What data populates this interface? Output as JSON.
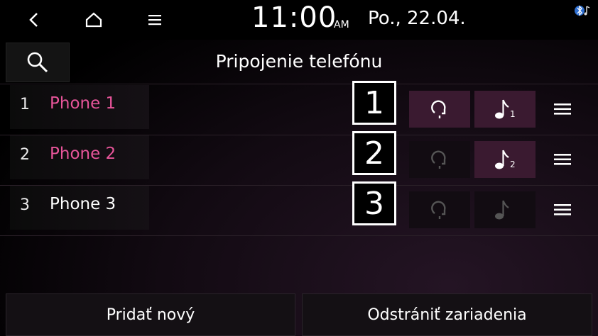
{
  "statusbar": {
    "time": "11:00",
    "ampm": "AM",
    "date": "Po., 22.04.",
    "icons": [
      "back-icon",
      "home-icon",
      "menu-icon",
      "bluetooth-audio-icon"
    ]
  },
  "header": {
    "title": "Pripojenie telefónu",
    "search_icon": "search-icon"
  },
  "phones": [
    {
      "number": "1",
      "name": "Phone 1",
      "name_color": "#e8559a",
      "callout": "1",
      "handsfree_on": true,
      "audio_on": true,
      "audio_badge": "1"
    },
    {
      "number": "2",
      "name": "Phone 2",
      "name_color": "#e8559a",
      "callout": "2",
      "handsfree_on": false,
      "audio_on": true,
      "audio_badge": "2"
    },
    {
      "number": "3",
      "name": "Phone 3",
      "name_color": "#ffffff",
      "callout": "3",
      "handsfree_on": false,
      "audio_on": false,
      "audio_badge": ""
    }
  ],
  "footer": {
    "add_label": "Pridať nový",
    "remove_label": "Odstrániť zariadenia"
  },
  "colors": {
    "accent_pink": "#e8559a",
    "active_button": "#3a1a30"
  }
}
